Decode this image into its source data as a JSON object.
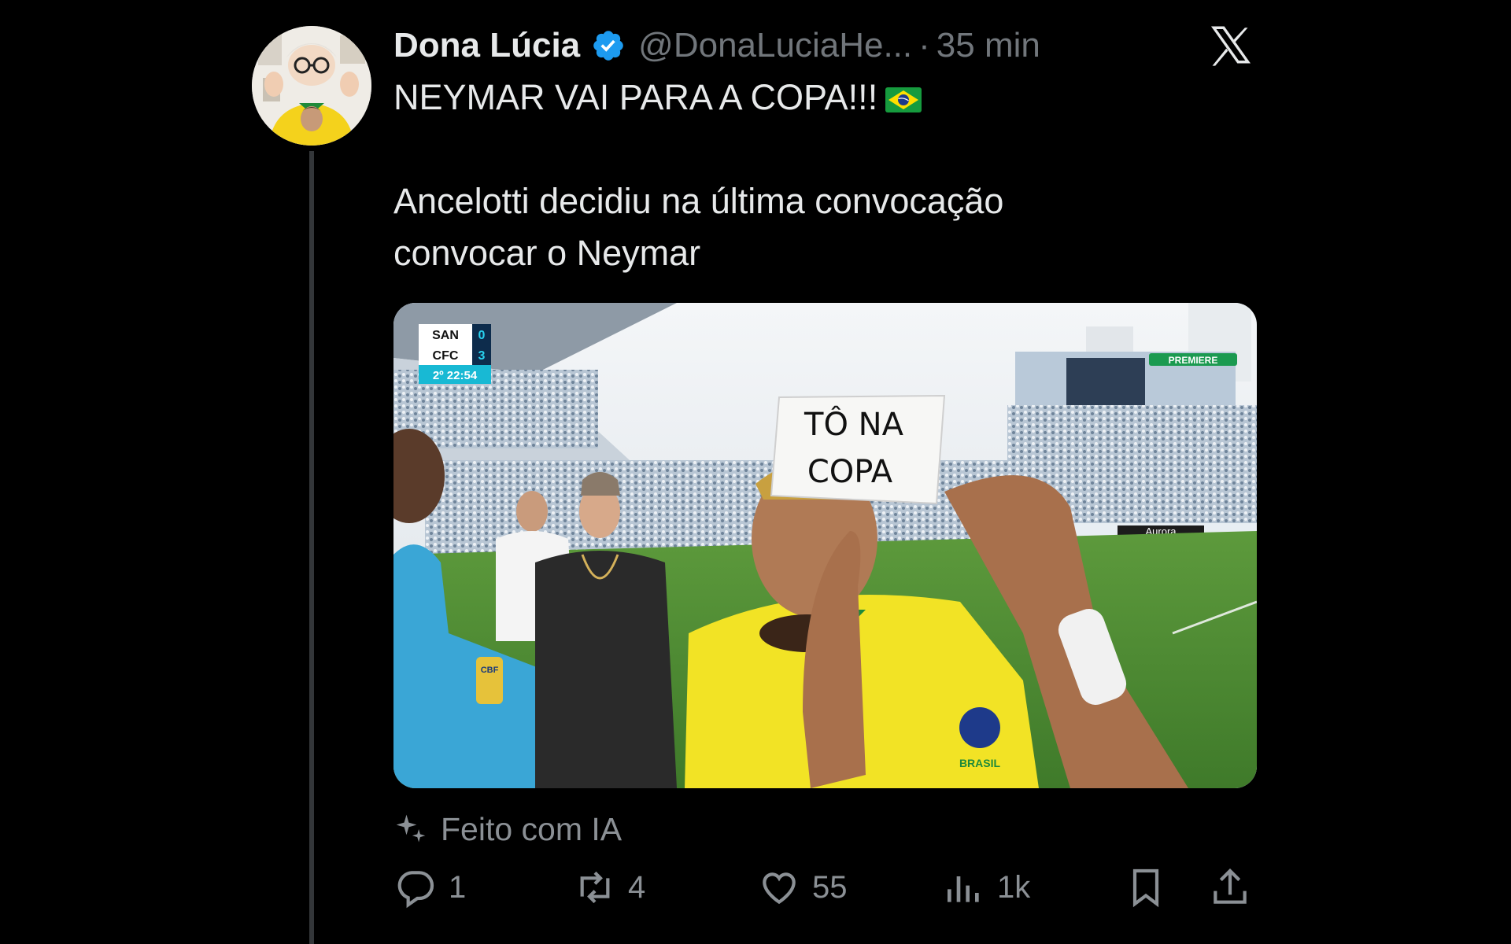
{
  "tweet": {
    "display_name": "Dona Lúcia",
    "handle": "@DonaLuciaHe...",
    "separator": "·",
    "time": "35 min",
    "text_line1": "NEYMAR VAI PARA A COPA!!!",
    "text_line2": "Ancelotti decidiu na última convocação",
    "text_line3": "convocar o Neymar",
    "ai_label": "Feito com IA"
  },
  "media": {
    "scoreboard_team1": "SAN",
    "scoreboard_score1": "0",
    "scoreboard_team2": "CFC",
    "scoreboard_score2": "3",
    "scoreboard_clock": "2º 22:54",
    "broadcaster": "PREMIERE",
    "sign_line1": "TÔ NA",
    "sign_line2": "COPA",
    "ad_board": "Aurora",
    "jersey_text": "BRASIL",
    "badge_text": "CBF"
  },
  "actions": {
    "replies": "1",
    "reposts": "4",
    "likes": "55",
    "views": "1k"
  },
  "icons": {
    "verified": "verified-badge-icon",
    "logo": "x-logo-icon",
    "ai": "sparkle-icon",
    "reply": "reply-icon",
    "repost": "repost-icon",
    "like": "heart-icon",
    "views": "views-icon",
    "bookmark": "bookmark-icon",
    "share": "share-icon"
  },
  "colors": {
    "background": "#000000",
    "text": "#e7e9ea",
    "muted": "#71767b",
    "verified": "#1d9bf0"
  }
}
